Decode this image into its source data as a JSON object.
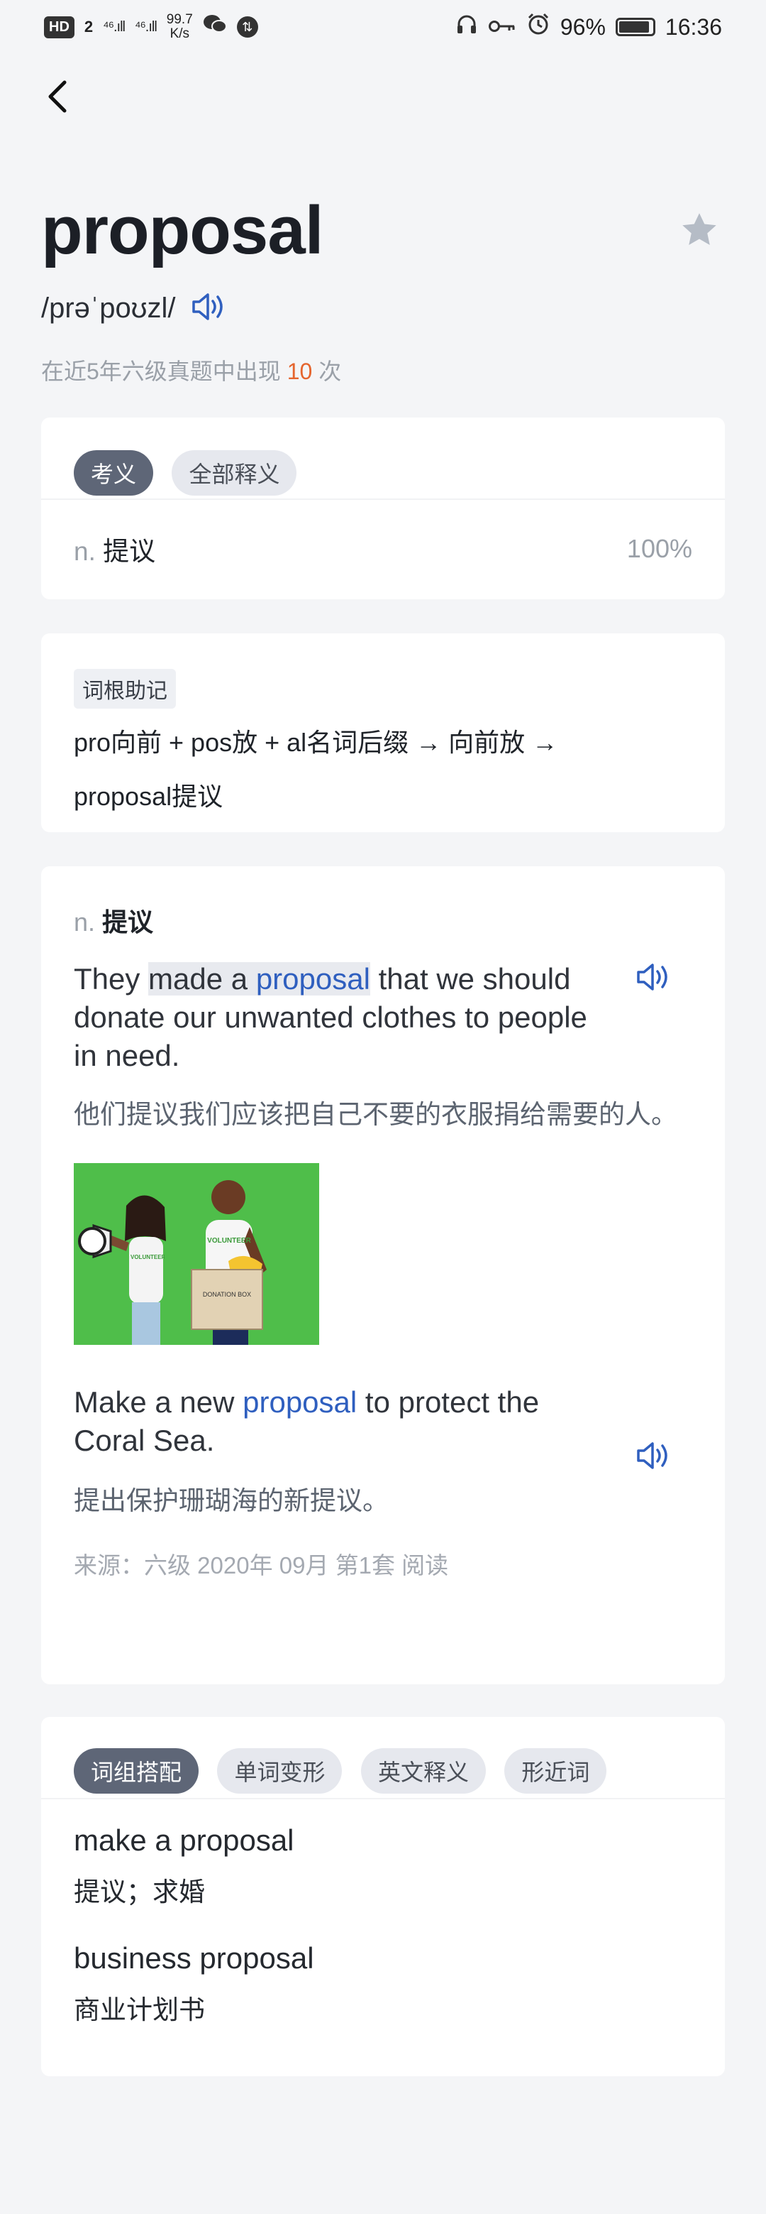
{
  "status_bar": {
    "hd": "HD",
    "sim": "2",
    "signal1": "⁴⁶.ıll",
    "signal2": "⁴⁶.ıll",
    "speed_value": "99.7",
    "speed_unit": "K/s",
    "battery": "96%",
    "battery_level": 0.96,
    "time": "16:36"
  },
  "header": {
    "word": "proposal",
    "phonetic": "/prəˈpoʊzl/",
    "frequency_prefix": "在近5年六级真题中出现",
    "frequency_count": "10",
    "frequency_suffix": "次"
  },
  "meaning_card": {
    "tabs": [
      {
        "label": "考义",
        "active": true
      },
      {
        "label": "全部释义",
        "active": false
      }
    ],
    "pos": "n.",
    "definition": "提议",
    "percent": "100%"
  },
  "memo_card": {
    "tag": "词根助记",
    "line1": "pro向前 + pos放 + al名词后缀 → 向前放 →",
    "line2": "proposal提议"
  },
  "example_card": {
    "pos": "n.",
    "sense": "提议",
    "example1": {
      "en_before": "They ",
      "en_highlight": "made a ",
      "en_keyword": "proposal",
      "en_after": " that we should donate our unwanted clothes to people in need.",
      "zh": "他们提议我们应该把自己不要的衣服捐给需要的人。"
    },
    "image_text": {
      "shirt_left": "VOLUNTEER",
      "shirt_right": "VOLUNTEER",
      "box": "DONATION BOX"
    },
    "example2": {
      "en_before": "Make a new ",
      "en_keyword": "proposal",
      "en_after": " to protect the Coral Sea.",
      "zh": "提出保护珊瑚海的新提议。"
    },
    "source": "来源：六级 2020年 09月 第1套 阅读"
  },
  "phrase_card": {
    "tabs": [
      {
        "label": "词组搭配",
        "active": true
      },
      {
        "label": "单词变形",
        "active": false
      },
      {
        "label": "英文释义",
        "active": false
      },
      {
        "label": "形近词",
        "active": false
      }
    ],
    "phrases": [
      {
        "en": "make a proposal",
        "zh": "提议；求婚"
      },
      {
        "en": "business proposal",
        "zh": "商业计划书"
      }
    ]
  },
  "colors": {
    "keyword": "#2f5fbf",
    "frequency_count": "#e5652e",
    "active_chip": "#5e6677",
    "image_background": "#4fbe4a"
  }
}
